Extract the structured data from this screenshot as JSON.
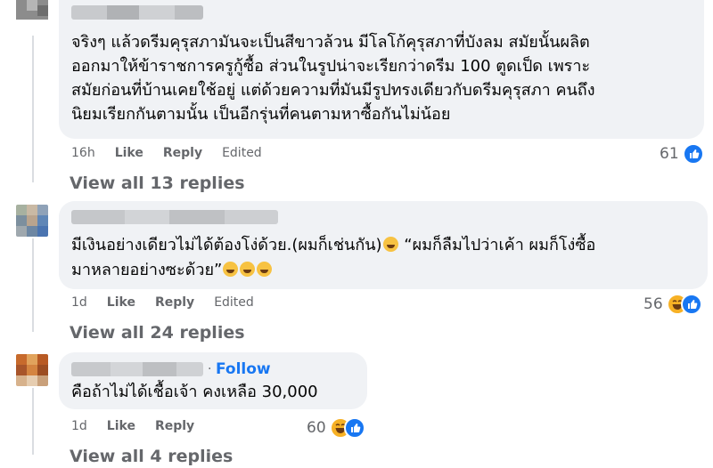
{
  "comments": [
    {
      "text_lines": [
        "จริงๆ แล้วดรีมคุรุสภามันจะเป็นสีขาวล้วน มีโลโก้คุรุสภาที่บังลม สมัยนั้นผลิต",
        "ออกมาให้ข้าราชการครูกู้ซื้อ ส่วนในรูปน่าจะเรียกว่าดรีม 100 ตูดเป็ด เพราะ",
        "สมัยก่อนที่บ้านเคยใช้อยู่ แต่ด้วยความที่มันมีรูปทรงเดียวกับดรีมคุรุสภา คนถึง",
        "นิยมเรียกกันตามนั้น เป็นอีกรุ่นที่คนตามหาซื้อกันไม่น้อย"
      ],
      "time": "16h",
      "like_label": "Like",
      "reply_label": "Reply",
      "edited_label": "Edited",
      "reaction_count": "61",
      "reaction_icons": [
        "like-icon"
      ],
      "view_replies": "View all 13 replies"
    },
    {
      "text_line1": "มีเงินอย่างเดียวไม่ได้ต้องโง่ด้วย.(ผมก็เช่นกัน)",
      "text_line1b": " “ผมก็ลืมไปว่าเค้า ผมก็โง่ซื้อ",
      "text_line2": "มาหลายอย่างซะด้วย”",
      "emoji_name": "grinning-face-emoji",
      "time": "1d",
      "like_label": "Like",
      "reply_label": "Reply",
      "edited_label": "Edited",
      "reaction_count": "56",
      "reaction_icons": [
        "haha-icon",
        "like-icon"
      ],
      "view_replies": "View all 24 replies"
    },
    {
      "follow_sep": "·",
      "follow_label": "Follow",
      "text": "คือถ้าไม่ได้เชื้อเจ้า คงเหลือ 30,000",
      "time": "1d",
      "like_label": "Like",
      "reply_label": "Reply",
      "reaction_count": "60",
      "reaction_icons": [
        "haha-icon",
        "like-icon"
      ],
      "view_replies": "View all 4 replies"
    }
  ],
  "colors": {
    "bubble": "#f0f2f5",
    "link_blue": "#1877f2",
    "meta_gray": "#65676b",
    "haha_yellow": "#f7b125"
  }
}
